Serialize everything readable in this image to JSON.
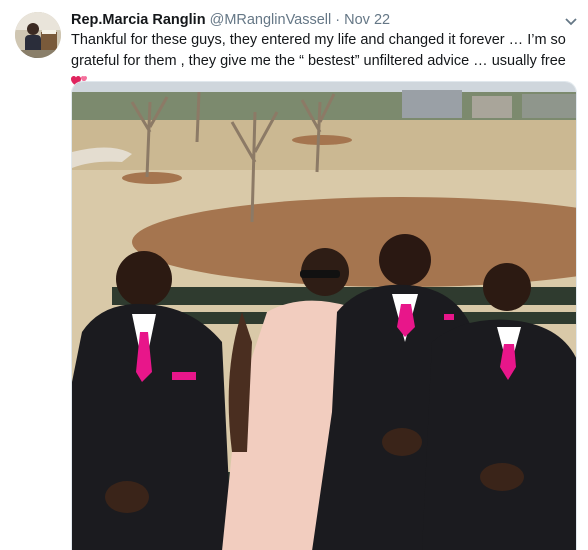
{
  "tweet": {
    "author_name": "Rep.Marcia Ranglin",
    "handle": "@MRanglinVassell",
    "separator": "·",
    "date": "Nov 22",
    "text": "Thankful for these guys, they entered my life and changed it forever … I’m so grateful for them , they give me the “ bestest” unfiltered advice … usually free",
    "emoji_icon": "two-hearts-icon",
    "menu_icon": "chevron-down-icon"
  },
  "colors": {
    "name": "#14171a",
    "secondary": "#657786",
    "heart": "#e0245e",
    "tie": "#e8168a",
    "suit": "#1b1b1f",
    "dress": "#f2cdbf"
  }
}
